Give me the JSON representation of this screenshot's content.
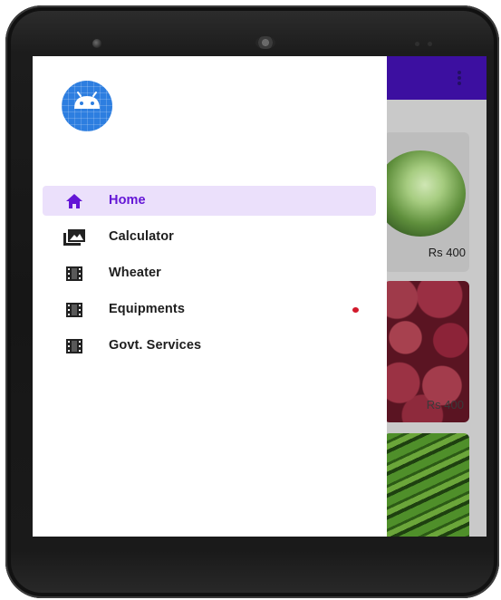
{
  "drawer": {
    "header": {
      "icon": "android-icon"
    },
    "items": [
      {
        "label": "Home",
        "icon": "home-icon",
        "active": true
      },
      {
        "label": "Calculator",
        "icon": "photo-library-icon",
        "active": false
      },
      {
        "label": "Wheater",
        "icon": "film-icon",
        "active": false
      },
      {
        "label": "Equipments",
        "icon": "film-icon",
        "active": false,
        "badge": true
      },
      {
        "label": "Govt. Services",
        "icon": "film-icon",
        "active": false
      }
    ]
  },
  "products": [
    {
      "name": "cabbage",
      "price": "Rs 400"
    },
    {
      "name": "onion",
      "price": "Rs 400"
    },
    {
      "name": "okra",
      "price": ""
    }
  ],
  "colors": {
    "appbar": "#3c0fa0",
    "accent": "#6416d6",
    "active_background": "#ebe0fb",
    "badge": "#d2192b",
    "avatar": "#2d7ee0"
  }
}
